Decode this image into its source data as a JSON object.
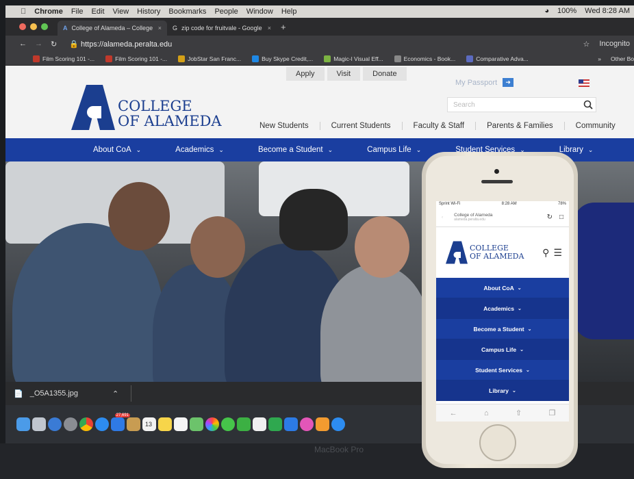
{
  "mac_menubar": {
    "app": "Chrome",
    "items": [
      "File",
      "Edit",
      "View",
      "History",
      "Bookmarks",
      "People",
      "Window",
      "Help"
    ],
    "battery": "100%",
    "clock": "Wed 8:28 AM"
  },
  "browser": {
    "tabs": [
      {
        "title": "College of Alameda – College",
        "active": true
      },
      {
        "title": "zip code for fruitvale - Google",
        "active": false
      }
    ],
    "url": "https://alameda.peralta.edu",
    "profile": "Incognito",
    "bookmarks": [
      {
        "label": "Film Scoring 101 -...",
        "color": "#c0392b"
      },
      {
        "label": "Film Scoring 101 -...",
        "color": "#c0392b"
      },
      {
        "label": "JobStar San Franc...",
        "color": "#d4a017"
      },
      {
        "label": "Buy Skype Credit,...",
        "color": "#1e88e5"
      },
      {
        "label": "Magic-l Visual Eff...",
        "color": "#7cb342"
      },
      {
        "label": "Economics - Book...",
        "color": "#888888"
      },
      {
        "label": "Comparative Adva...",
        "color": "#5c6bc0"
      }
    ],
    "other_bookmarks": "Other Bo"
  },
  "site": {
    "utility_links": [
      "Apply",
      "Visit",
      "Donate"
    ],
    "passport": "My Passport",
    "logo_line1": "COLLEGE",
    "logo_line2": "OF ALAMEDA",
    "search_placeholder": "Search",
    "audience_links": [
      "New Students",
      "Current Students",
      "Faculty & Staff",
      "Parents & Families",
      "Community"
    ],
    "main_nav": [
      "About CoA",
      "Academics",
      "Become a Student",
      "Campus Life",
      "Student Services",
      "Library"
    ]
  },
  "downloads": {
    "file": "_O5A1355.jpg"
  },
  "dock_badges": [
    "27,691",
    "13"
  ],
  "laptop_brand": "MacBook Pro",
  "phone": {
    "status_left": "Sprint Wi-Fi",
    "status_time": "8:28 AM",
    "status_right": "78%",
    "page_title": "College of Alameda",
    "page_url": "alameda.peralta.edu",
    "logo_line1": "COLLEGE",
    "logo_line2": "OF ALAMEDA",
    "nav": [
      "About CoA",
      "Academics",
      "Become a Student",
      "Campus Life",
      "Student Services",
      "Library"
    ]
  },
  "colors": {
    "brand_blue": "#1a3ea0",
    "logo_blue": "#1b3e8f"
  }
}
